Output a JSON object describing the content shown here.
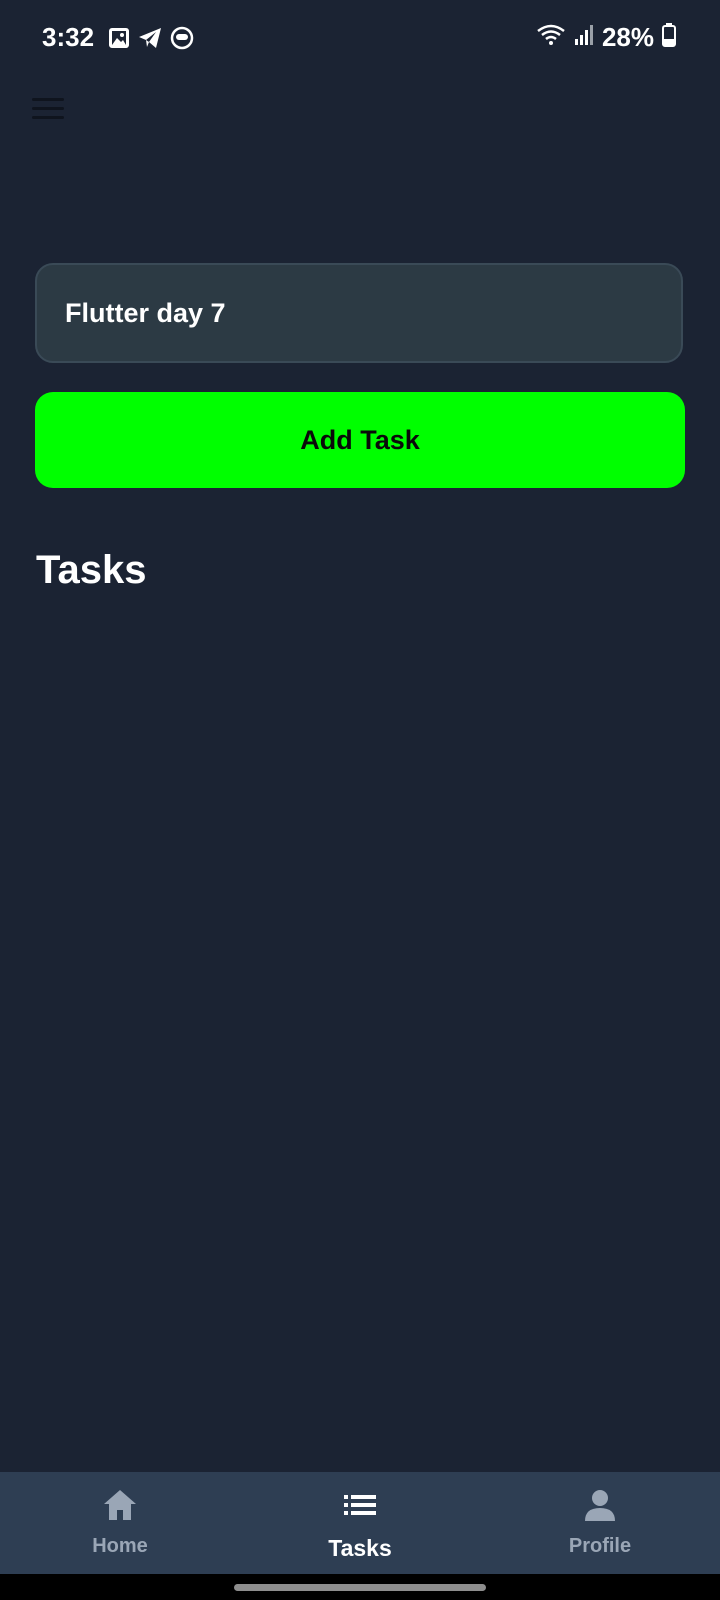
{
  "status_bar": {
    "time": "3:32",
    "battery": "28%",
    "left_icons": [
      "image-icon",
      "telegram-icon",
      "app-face-icon"
    ],
    "right_icons": [
      "wifi-icon",
      "signal-icon",
      "battery-icon"
    ]
  },
  "task_form": {
    "input_value": "Flutter day 7",
    "add_button_label": "Add Task",
    "accent_color": "#00ff00"
  },
  "tasks": {
    "title": "Tasks",
    "items": []
  },
  "bottom_nav": {
    "items": [
      {
        "label": "Home",
        "icon": "home-icon",
        "active": false
      },
      {
        "label": "Tasks",
        "icon": "list-icon",
        "active": true
      },
      {
        "label": "Profile",
        "icon": "person-icon",
        "active": false
      }
    ]
  },
  "colors": {
    "background": "#1b2333",
    "input_background": "#2c3a44",
    "nav_background": "#2e3e53"
  }
}
